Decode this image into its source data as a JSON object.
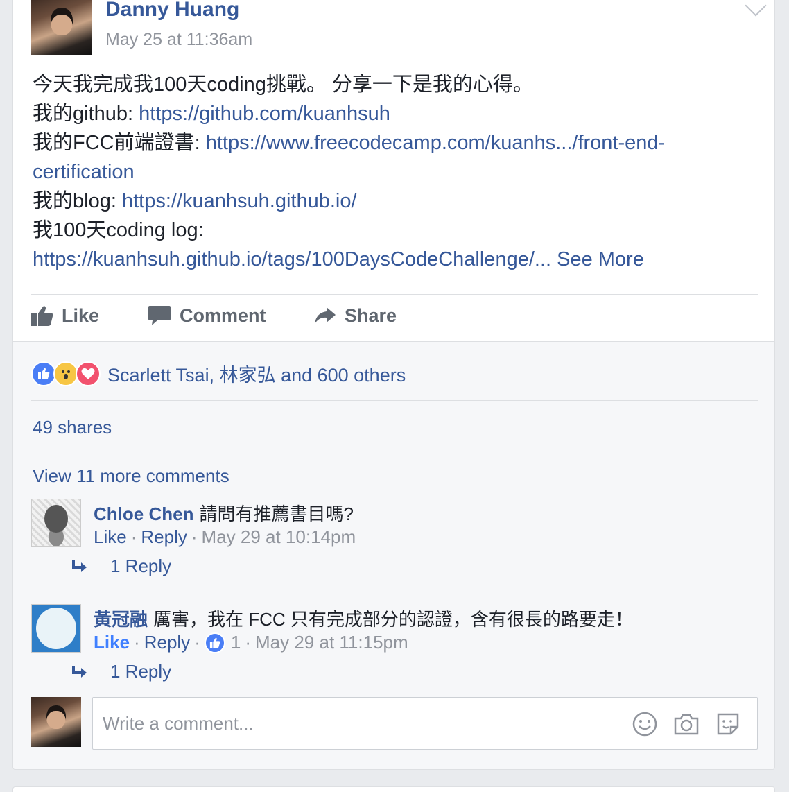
{
  "post": {
    "author": "Danny Huang",
    "timestamp": "May 25 at 11:36am",
    "lines": [
      {
        "text": "今天我完成我100天coding挑戰。 分享一下是我的心得。",
        "link": ""
      },
      {
        "text": "我的github: ",
        "link": "https://github.com/kuanhsuh"
      },
      {
        "text": "我的FCC前端證書: ",
        "link": "https://www.freecodecamp.com/kuanhs.../front-end-"
      },
      {
        "text": "",
        "link": "certification"
      },
      {
        "text": "我的blog: ",
        "link": "https://kuanhsuh.github.io/"
      },
      {
        "text": "我100天coding log:",
        "link": ""
      },
      {
        "text": "",
        "link": "https://kuanhsuh.github.io/tags/100DaysCodeChallenge/..."
      }
    ],
    "see_more": " See More"
  },
  "actions": {
    "like": "Like",
    "comment": "Comment",
    "share": "Share"
  },
  "reactions": {
    "icons": [
      "like-reaction",
      "wow-reaction",
      "love-reaction"
    ],
    "summary": "Scarlett Tsai, 林家弘 and 600 others"
  },
  "shares": "49 shares",
  "view_more_comments": "View 11 more comments",
  "comments": [
    {
      "name": "Chloe Chen",
      "text": "請問有推薦書目嗎?",
      "like": "Like",
      "reply": "Reply",
      "time": "May 29 at 10:14pm",
      "reply_count": "1 Reply"
    },
    {
      "name": "黃冠融",
      "text": "厲害，我在 FCC 只有完成部分的認證，含有很長的路要走！",
      "like": "Like",
      "reply": "Reply",
      "like_count": "1",
      "time": "May 29 at 11:15pm",
      "reply_count": "1 Reply"
    }
  ],
  "composer": {
    "placeholder": "Write a comment..."
  },
  "colors": {
    "link": "#365899",
    "secondary_text": "#90949c",
    "like_blue": "#4a7ef6",
    "love_red": "#f2526e",
    "wow_yellow": "#f7c644"
  }
}
